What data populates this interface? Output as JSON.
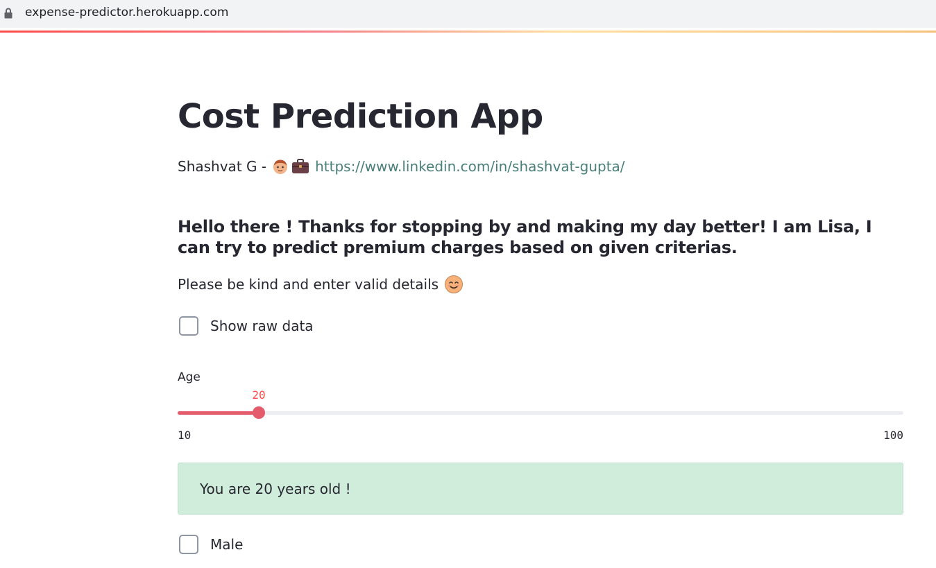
{
  "browser": {
    "url": "expense-predictor.herokuapp.com"
  },
  "app": {
    "title": "Cost Prediction App",
    "author_prefix": "Shashvat G -",
    "author_link": "https://www.linkedin.com/in/shashvat-gupta/",
    "greeting": "Hello there ! Thanks for stopping by and making my day better! I am Lisa, I can try to predict premium charges based on given criterias.",
    "kind_text": "Please be kind and enter valid details",
    "show_raw_data_label": "Show raw data",
    "age_slider": {
      "label": "Age",
      "value": 20,
      "value_text": "20",
      "min": 10,
      "max": 100,
      "min_text": "10",
      "max_text": "100"
    },
    "age_message": "You are 20 years old !",
    "male_label": "Male"
  },
  "colors": {
    "accent": "#e45b6b",
    "slider_value_text": "#ff4b4b",
    "success_bg": "#d0ecdb",
    "link": "#4a7f7a",
    "text": "#262730"
  },
  "icons": {
    "lock": "lock-icon",
    "face": "person-emoji-icon",
    "briefcase": "briefcase-emoji-icon",
    "smile": "smiling-face-emoji-icon"
  }
}
